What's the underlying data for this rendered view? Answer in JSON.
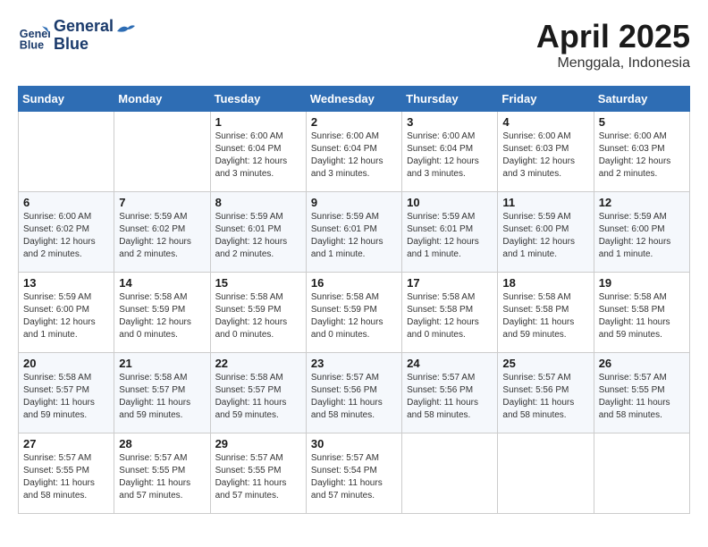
{
  "header": {
    "logo_line1": "General",
    "logo_line2": "Blue",
    "title": "April 2025",
    "subtitle": "Menggala, Indonesia"
  },
  "days_of_week": [
    "Sunday",
    "Monday",
    "Tuesday",
    "Wednesday",
    "Thursday",
    "Friday",
    "Saturday"
  ],
  "weeks": [
    [
      {
        "day": "",
        "info": ""
      },
      {
        "day": "",
        "info": ""
      },
      {
        "day": "1",
        "info": "Sunrise: 6:00 AM\nSunset: 6:04 PM\nDaylight: 12 hours\nand 3 minutes."
      },
      {
        "day": "2",
        "info": "Sunrise: 6:00 AM\nSunset: 6:04 PM\nDaylight: 12 hours\nand 3 minutes."
      },
      {
        "day": "3",
        "info": "Sunrise: 6:00 AM\nSunset: 6:04 PM\nDaylight: 12 hours\nand 3 minutes."
      },
      {
        "day": "4",
        "info": "Sunrise: 6:00 AM\nSunset: 6:03 PM\nDaylight: 12 hours\nand 3 minutes."
      },
      {
        "day": "5",
        "info": "Sunrise: 6:00 AM\nSunset: 6:03 PM\nDaylight: 12 hours\nand 2 minutes."
      }
    ],
    [
      {
        "day": "6",
        "info": "Sunrise: 6:00 AM\nSunset: 6:02 PM\nDaylight: 12 hours\nand 2 minutes."
      },
      {
        "day": "7",
        "info": "Sunrise: 5:59 AM\nSunset: 6:02 PM\nDaylight: 12 hours\nand 2 minutes."
      },
      {
        "day": "8",
        "info": "Sunrise: 5:59 AM\nSunset: 6:01 PM\nDaylight: 12 hours\nand 2 minutes."
      },
      {
        "day": "9",
        "info": "Sunrise: 5:59 AM\nSunset: 6:01 PM\nDaylight: 12 hours\nand 1 minute."
      },
      {
        "day": "10",
        "info": "Sunrise: 5:59 AM\nSunset: 6:01 PM\nDaylight: 12 hours\nand 1 minute."
      },
      {
        "day": "11",
        "info": "Sunrise: 5:59 AM\nSunset: 6:00 PM\nDaylight: 12 hours\nand 1 minute."
      },
      {
        "day": "12",
        "info": "Sunrise: 5:59 AM\nSunset: 6:00 PM\nDaylight: 12 hours\nand 1 minute."
      }
    ],
    [
      {
        "day": "13",
        "info": "Sunrise: 5:59 AM\nSunset: 6:00 PM\nDaylight: 12 hours\nand 1 minute."
      },
      {
        "day": "14",
        "info": "Sunrise: 5:58 AM\nSunset: 5:59 PM\nDaylight: 12 hours\nand 0 minutes."
      },
      {
        "day": "15",
        "info": "Sunrise: 5:58 AM\nSunset: 5:59 PM\nDaylight: 12 hours\nand 0 minutes."
      },
      {
        "day": "16",
        "info": "Sunrise: 5:58 AM\nSunset: 5:59 PM\nDaylight: 12 hours\nand 0 minutes."
      },
      {
        "day": "17",
        "info": "Sunrise: 5:58 AM\nSunset: 5:58 PM\nDaylight: 12 hours\nand 0 minutes."
      },
      {
        "day": "18",
        "info": "Sunrise: 5:58 AM\nSunset: 5:58 PM\nDaylight: 11 hours\nand 59 minutes."
      },
      {
        "day": "19",
        "info": "Sunrise: 5:58 AM\nSunset: 5:58 PM\nDaylight: 11 hours\nand 59 minutes."
      }
    ],
    [
      {
        "day": "20",
        "info": "Sunrise: 5:58 AM\nSunset: 5:57 PM\nDaylight: 11 hours\nand 59 minutes."
      },
      {
        "day": "21",
        "info": "Sunrise: 5:58 AM\nSunset: 5:57 PM\nDaylight: 11 hours\nand 59 minutes."
      },
      {
        "day": "22",
        "info": "Sunrise: 5:58 AM\nSunset: 5:57 PM\nDaylight: 11 hours\nand 59 minutes."
      },
      {
        "day": "23",
        "info": "Sunrise: 5:57 AM\nSunset: 5:56 PM\nDaylight: 11 hours\nand 58 minutes."
      },
      {
        "day": "24",
        "info": "Sunrise: 5:57 AM\nSunset: 5:56 PM\nDaylight: 11 hours\nand 58 minutes."
      },
      {
        "day": "25",
        "info": "Sunrise: 5:57 AM\nSunset: 5:56 PM\nDaylight: 11 hours\nand 58 minutes."
      },
      {
        "day": "26",
        "info": "Sunrise: 5:57 AM\nSunset: 5:55 PM\nDaylight: 11 hours\nand 58 minutes."
      }
    ],
    [
      {
        "day": "27",
        "info": "Sunrise: 5:57 AM\nSunset: 5:55 PM\nDaylight: 11 hours\nand 58 minutes."
      },
      {
        "day": "28",
        "info": "Sunrise: 5:57 AM\nSunset: 5:55 PM\nDaylight: 11 hours\nand 57 minutes."
      },
      {
        "day": "29",
        "info": "Sunrise: 5:57 AM\nSunset: 5:55 PM\nDaylight: 11 hours\nand 57 minutes."
      },
      {
        "day": "30",
        "info": "Sunrise: 5:57 AM\nSunset: 5:54 PM\nDaylight: 11 hours\nand 57 minutes."
      },
      {
        "day": "",
        "info": ""
      },
      {
        "day": "",
        "info": ""
      },
      {
        "day": "",
        "info": ""
      }
    ]
  ]
}
